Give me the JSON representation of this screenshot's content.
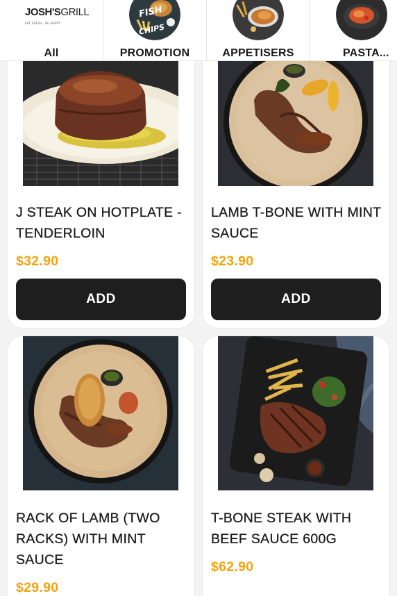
{
  "brand": {
    "logo_text_bold": "JOSH'S",
    "logo_text_thin": "GRILL",
    "logo_tagline": "EAT FRESH · BE HAPPY"
  },
  "categories": [
    {
      "label": "All"
    },
    {
      "label": "PROMOTION",
      "thumb_text_top": "FISH",
      "thumb_text_bottom": "CHIPS"
    },
    {
      "label": "APPETISERS"
    },
    {
      "label": "PASTA..."
    }
  ],
  "products": [
    {
      "name": "J STEAK ON HOTPLATE - TENDERLOIN",
      "price": "$32.90",
      "button": "ADD"
    },
    {
      "name": "LAMB T-BONE WITH MINT SAUCE",
      "price": "$23.90",
      "button": "ADD"
    },
    {
      "name": "RACK OF LAMB (TWO RACKS) WITH MINT SAUCE",
      "price": "$29.90"
    },
    {
      "name": "T-BONE STEAK WITH BEEF SAUCE 600G",
      "price": "$62.90"
    }
  ],
  "colors": {
    "price": "#f6a20c",
    "button_bg": "#1e1e1e",
    "button_text": "#ffffff"
  }
}
